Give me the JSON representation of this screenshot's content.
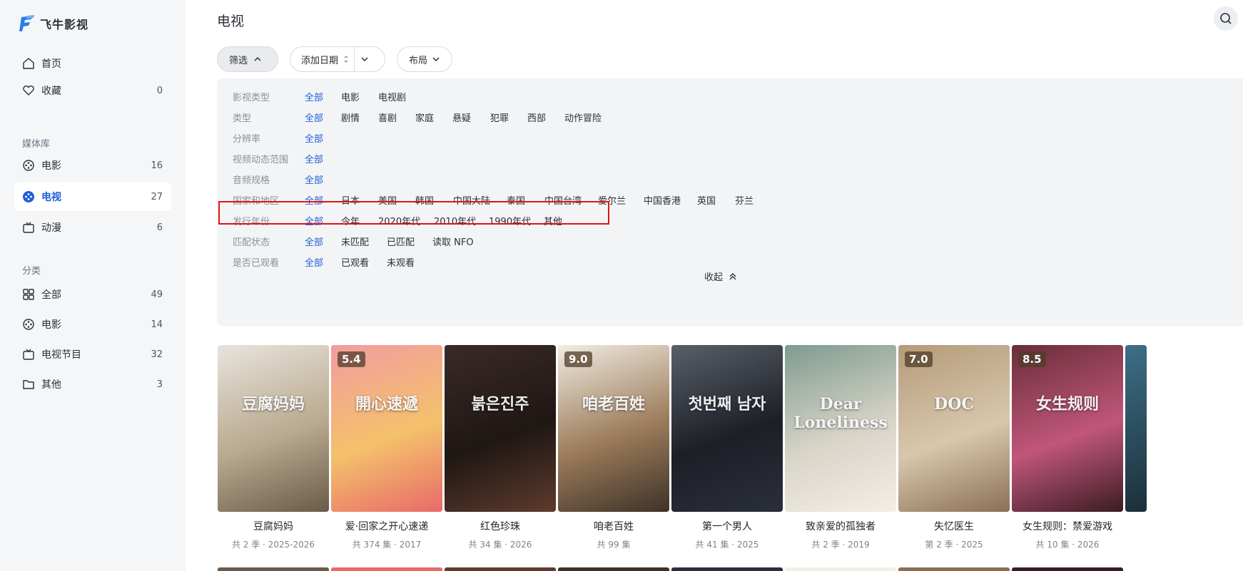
{
  "app": {
    "name": "飞牛影视"
  },
  "sidebar": {
    "items": [
      {
        "label": "首页",
        "count": "",
        "icon": "home-icon"
      },
      {
        "label": "收藏",
        "count": "0",
        "icon": "heart-icon"
      }
    ],
    "library_title": "媒体库",
    "library": [
      {
        "label": "电影",
        "count": "16",
        "icon": "film-reel-icon"
      },
      {
        "label": "电视",
        "count": "27",
        "icon": "film-reel-icon",
        "active": true
      },
      {
        "label": "动漫",
        "count": "6",
        "icon": "tv-icon"
      }
    ],
    "category_title": "分类",
    "categories": [
      {
        "label": "全部",
        "count": "49",
        "icon": "grid-icon"
      },
      {
        "label": "电影",
        "count": "14",
        "icon": "film-reel-icon"
      },
      {
        "label": "电视节目",
        "count": "32",
        "icon": "tv-icon"
      },
      {
        "label": "其他",
        "count": "3",
        "icon": "folder-icon"
      }
    ]
  },
  "header": {
    "title": "电视",
    "filter_label": "筛选",
    "sort_label": "添加日期",
    "layout_label": "布局"
  },
  "filters": [
    {
      "label": "影视类型",
      "options": [
        "全部",
        "电影",
        "电视剧"
      ]
    },
    {
      "label": "类型",
      "options": [
        "全部",
        "剧情",
        "喜剧",
        "家庭",
        "悬疑",
        "犯罪",
        "西部",
        "动作冒险"
      ]
    },
    {
      "label": "分辨率",
      "options": [
        "全部"
      ]
    },
    {
      "label": "视频动态范围",
      "options": [
        "全部"
      ]
    },
    {
      "label": "音频规格",
      "options": [
        "全部"
      ]
    },
    {
      "label": "国家和地区",
      "options": [
        "全部",
        "日本",
        "美国",
        "韩国",
        "中国大陆",
        "泰国",
        "中国台湾",
        "爱尔兰",
        "中国香港",
        "英国",
        "芬兰"
      ]
    },
    {
      "label": "发行年份",
      "options": [
        "全部",
        "今年",
        "2020年代",
        "2010年代",
        "1990年代",
        "其他"
      ]
    },
    {
      "label": "匹配状态",
      "options": [
        "全部",
        "未匹配",
        "已匹配",
        "读取 NFO"
      ]
    },
    {
      "label": "是否已观看",
      "options": [
        "全部",
        "已观看",
        "未观看"
      ]
    }
  ],
  "collapse_label": "收起",
  "posters": [
    {
      "title": "豆腐妈妈",
      "meta": "共 2 季 · 2025-2026",
      "rating": "",
      "poster_text": "豆腐妈妈",
      "colors": [
        "#e8e4dc",
        "#b9a98f",
        "#6b5a48"
      ]
    },
    {
      "title": "爱·回家之开心速递",
      "meta": "共 374 集 · 2017",
      "rating": "5.4",
      "poster_text": "開心速遞",
      "colors": [
        "#f29ca0",
        "#f4c16b",
        "#e86a6a"
      ]
    },
    {
      "title": "红色珍珠",
      "meta": "共 34 集 · 2026",
      "rating": "",
      "poster_text": "붉은진주",
      "colors": [
        "#3a2a26",
        "#1f1714",
        "#5e3b2c"
      ]
    },
    {
      "title": "咱老百姓",
      "meta": "共 99 集",
      "rating": "9.0",
      "poster_text": "咱老百姓",
      "colors": [
        "#f1ece2",
        "#9b7b5a",
        "#3e3228"
      ]
    },
    {
      "title": "第一个男人",
      "meta": "共 41 集 · 2025",
      "rating": "",
      "poster_text": "첫번째 남자",
      "colors": [
        "#5a5f68",
        "#1c1f26",
        "#2b2f3a"
      ]
    },
    {
      "title": "致亲爱的孤独者",
      "meta": "共 2 季 · 2019",
      "rating": "",
      "poster_text": "Dear Loneliness",
      "colors": [
        "#7e9b8f",
        "#d9d4c8",
        "#f3efe7"
      ]
    },
    {
      "title": "失忆医生",
      "meta": "第 2 季 · 2025",
      "rating": "7.0",
      "poster_text": "DOC",
      "colors": [
        "#b59a7a",
        "#d8c7ad",
        "#8a6f55"
      ]
    },
    {
      "title": "女生规则：禁爱游戏",
      "meta": "共 10 集 · 2026",
      "rating": "8.5",
      "poster_text": "女生规则",
      "colors": [
        "#6a2e3a",
        "#c0567a",
        "#3b1c24"
      ]
    }
  ]
}
